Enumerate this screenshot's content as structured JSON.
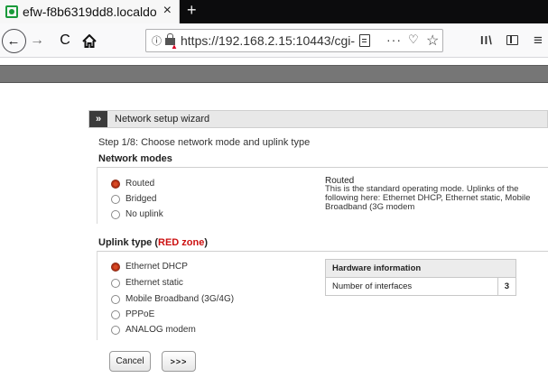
{
  "browser": {
    "tab_title": "efw-f8b6319dd8.localdo",
    "tab_close": "×",
    "new_tab": "+",
    "url": "https://192.168.2.15:10443/cgi-",
    "back": "←",
    "forward": "→",
    "reload": "C",
    "info": "ⓘ",
    "more": "···",
    "pocket": "♡",
    "star": "☆",
    "library": "II\\",
    "menu": "≡"
  },
  "wizard": {
    "collapse_icon": "»",
    "title": "Network setup wizard",
    "step": "Step 1/8: Choose network mode and uplink type",
    "network_modes_heading": "Network modes",
    "modes": [
      {
        "label": "Routed",
        "selected": true
      },
      {
        "label": "Bridged",
        "selected": false
      },
      {
        "label": "No uplink",
        "selected": false
      }
    ],
    "mode_desc_title": "Routed",
    "mode_desc_body": "This is the standard operating mode. Uplinks of the following here: Ethernet DHCP, Ethernet static, Mobile Broadband (3G modem",
    "uplink_heading_prefix": "Uplink type (",
    "uplink_heading_zone": "RED zone",
    "uplink_heading_suffix": ")",
    "uplink_types": [
      {
        "label": "Ethernet DHCP",
        "selected": true
      },
      {
        "label": "Ethernet static",
        "selected": false
      },
      {
        "label": "Mobile Broadband (3G/4G)",
        "selected": false
      },
      {
        "label": "PPPoE",
        "selected": false
      },
      {
        "label": "ANALOG modem",
        "selected": false
      }
    ],
    "hardware_info": {
      "header": "Hardware information",
      "row_label": "Number of interfaces",
      "row_value": "3"
    },
    "cancel_label": "Cancel",
    "next_label": ">>>"
  },
  "colors": {
    "selected_radio": "#d84a24",
    "red_zone": "#cc1111",
    "header_strip": "#767676"
  }
}
